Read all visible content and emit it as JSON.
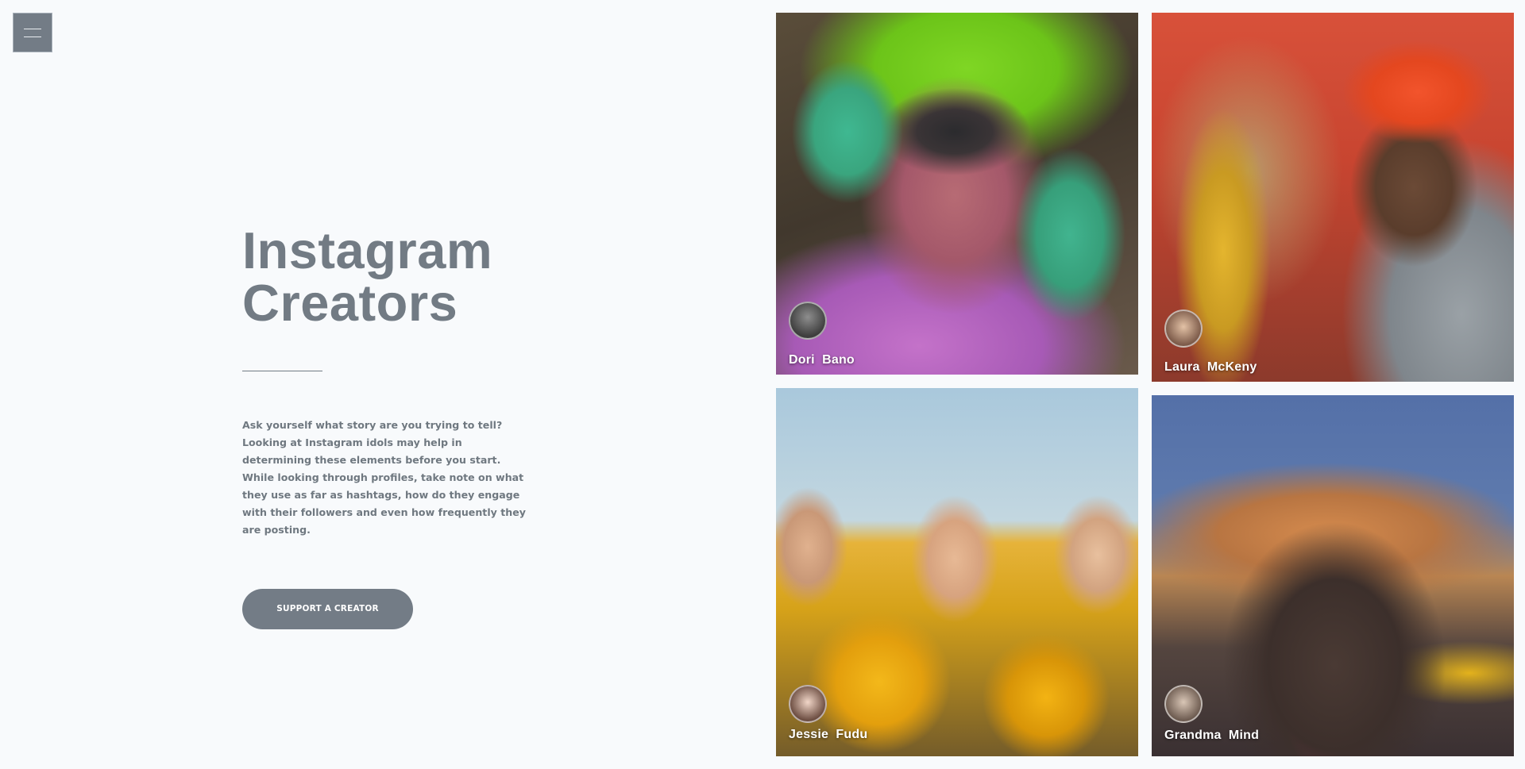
{
  "menu": {
    "icon": "hamburger-menu-icon"
  },
  "hero": {
    "title_line1": "Instagram",
    "title_line2": "Creators",
    "description": "Ask yourself what story are you trying to tell? Looking at Instagram idols may help in determining these elements before you start. While looking through profiles, take note on what they use as far as hashtags, how do they engage with their followers and even how frequently they are posting.",
    "cta_label": "SUPPORT A CREATOR"
  },
  "creators": [
    {
      "name": "Dori  Bano"
    },
    {
      "name": "Laura  McKeny"
    },
    {
      "name": "Jessie  Fudu"
    },
    {
      "name": "Grandma  Mind"
    }
  ],
  "colors": {
    "background": "#f8fafc",
    "text": "#727b84",
    "button": "#737c86"
  }
}
